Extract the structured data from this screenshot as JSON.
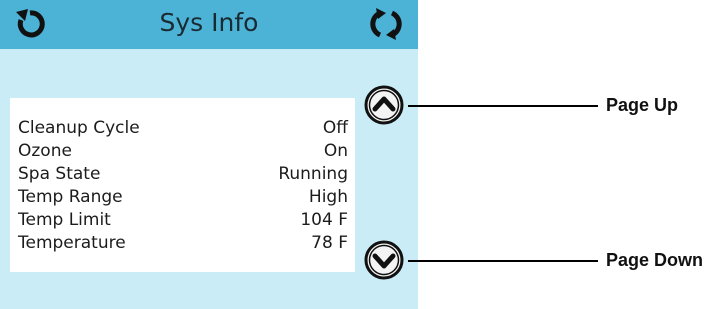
{
  "title": "Sys Info",
  "icons": {
    "back": "back-arrow-icon",
    "refresh": "refresh-icon",
    "up": "chevron-up-icon",
    "down": "chevron-down-icon"
  },
  "colors": {
    "titlebar": "#4db3d6",
    "screen_bg": "#c9ecf7",
    "panel_bg": "#ffffff"
  },
  "info": {
    "rows": [
      {
        "label": "Cleanup Cycle",
        "value": "Off"
      },
      {
        "label": "Ozone",
        "value": "On"
      },
      {
        "label": "Spa State",
        "value": "Running"
      },
      {
        "label": "Temp Range",
        "value": "High"
      },
      {
        "label": "Temp Limit",
        "value": "104 F"
      },
      {
        "label": "Temperature",
        "value": "78 F"
      }
    ]
  },
  "callouts": {
    "page_up": "Page Up",
    "page_down": "Page Down"
  }
}
